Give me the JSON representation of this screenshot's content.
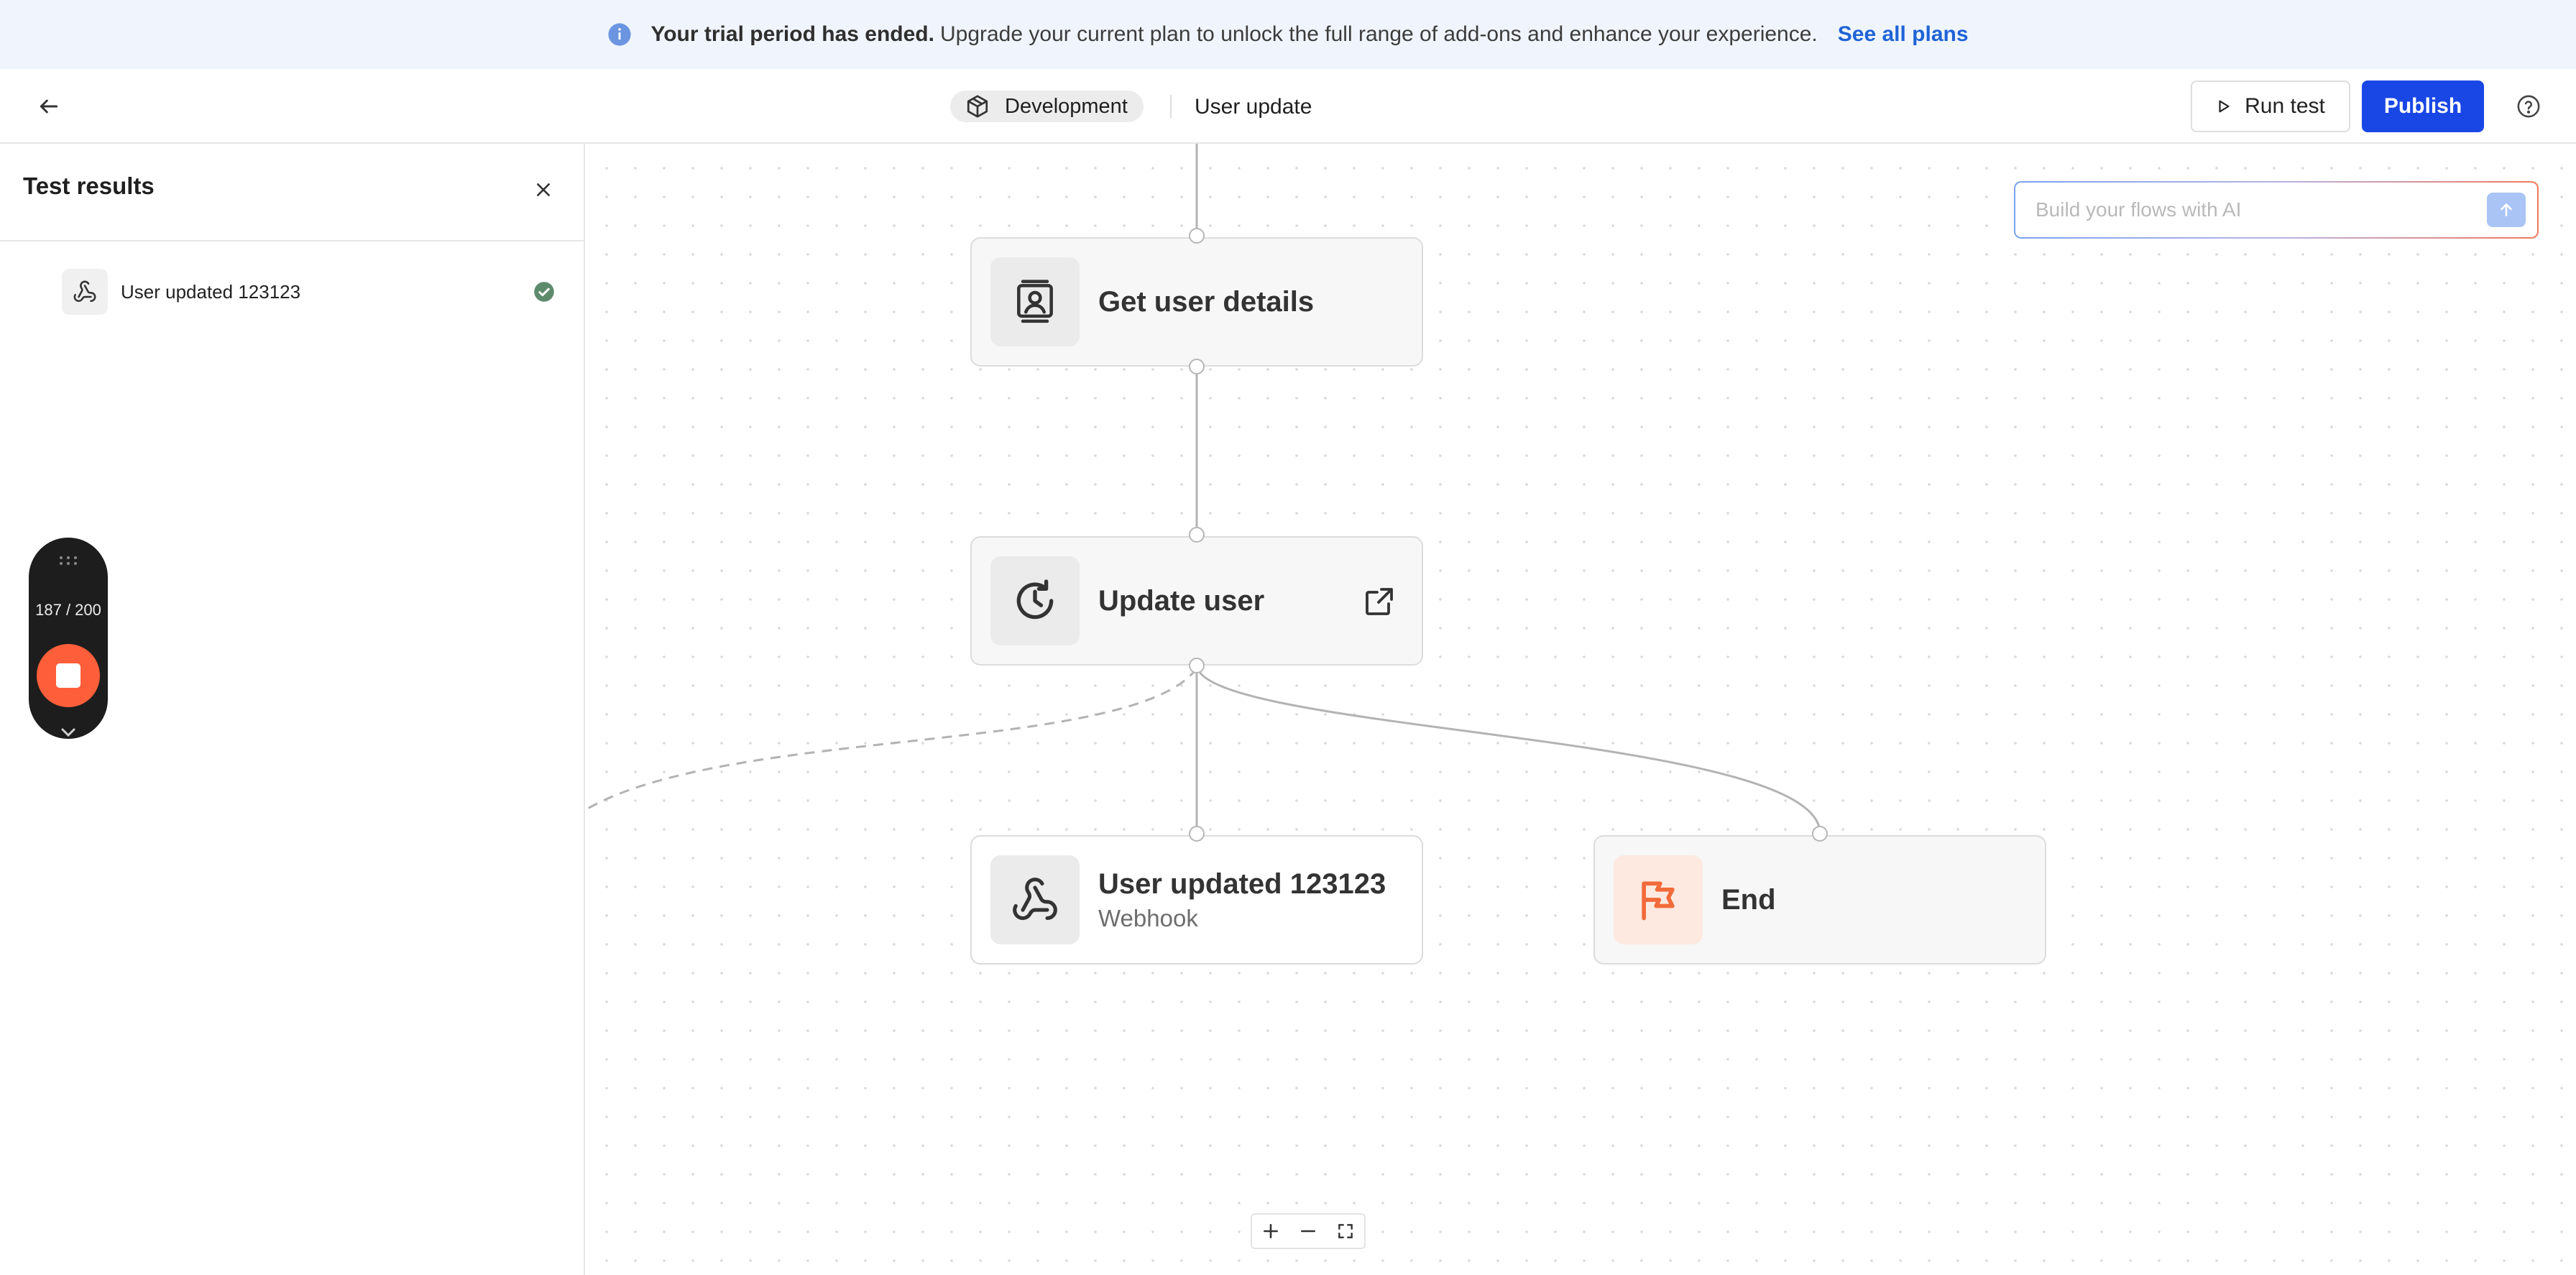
{
  "banner": {
    "bold_text": "Your trial period has ended.",
    "text": "Upgrade your current plan to unlock the full range of add-ons and enhance your experience.",
    "link_label": "See all plans",
    "icon": "info-icon"
  },
  "header": {
    "environment": "Development",
    "flow_name": "User update",
    "run_test_label": "Run test",
    "publish_label": "Publish"
  },
  "test_results": {
    "title": "Test results",
    "items": [
      {
        "label": "User updated 123123",
        "icon": "webhook-icon",
        "status": "success"
      }
    ]
  },
  "canvas": {
    "ai_placeholder": "Build your flows with AI",
    "nodes": [
      {
        "title": "Get user details",
        "icon": "user-card-icon"
      },
      {
        "title": "Update user",
        "icon": "refresh-clock-icon"
      },
      {
        "title": "User updated 123123",
        "subtitle": "Webhook",
        "icon": "webhook-icon"
      },
      {
        "title": "End",
        "icon": "flag-icon"
      }
    ]
  },
  "recorder": {
    "count": "187 / 200"
  },
  "colors": {
    "primary": "#1947e6",
    "banner_bg": "#f0f5fd",
    "link": "#1f63d6",
    "stop": "#ff5e3a",
    "flag": "#f26b3a",
    "success": "#5e8a6c"
  }
}
